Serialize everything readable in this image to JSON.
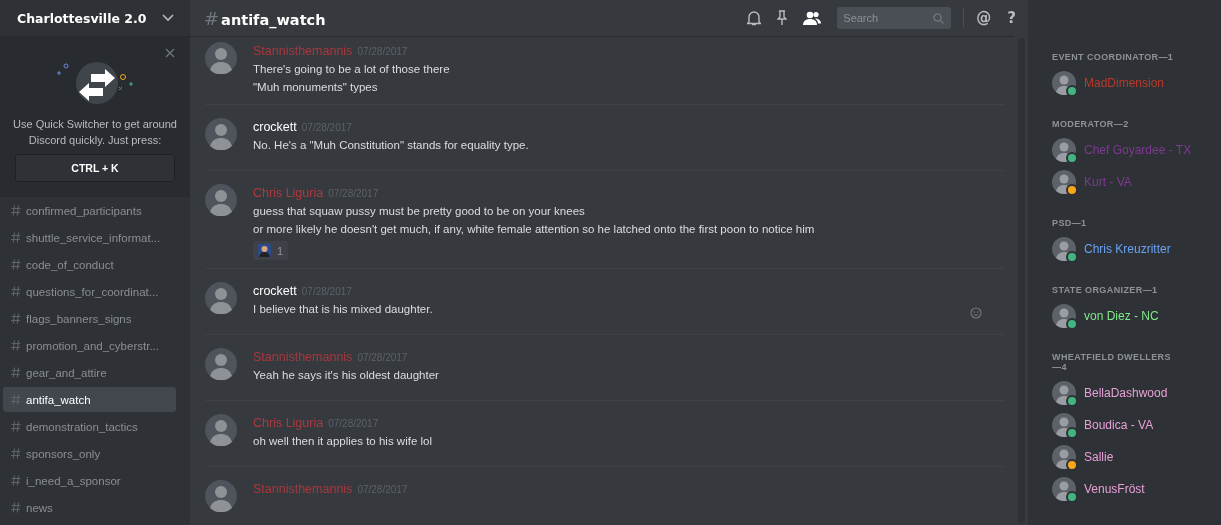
{
  "server": {
    "name": "Charlottesville 2.0"
  },
  "quick_switcher": {
    "text": "Use Quick Switcher to get around Discord quickly. Just press:",
    "shortcut": "CTRL + K"
  },
  "channels": [
    {
      "name": "confirmed_participants",
      "selected": false
    },
    {
      "name": "shuttle_service_informat...",
      "selected": false
    },
    {
      "name": "code_of_conduct",
      "selected": false
    },
    {
      "name": "questions_for_coordinat...",
      "selected": false
    },
    {
      "name": "flags_banners_signs",
      "selected": false
    },
    {
      "name": "promotion_and_cyberstr...",
      "selected": false
    },
    {
      "name": "gear_and_attire",
      "selected": false
    },
    {
      "name": "antifa_watch",
      "selected": true
    },
    {
      "name": "demonstration_tactics",
      "selected": false
    },
    {
      "name": "sponsors_only",
      "selected": false
    },
    {
      "name": "i_need_a_sponsor",
      "selected": false
    },
    {
      "name": "news",
      "selected": false
    }
  ],
  "channel_header": {
    "hash": "#",
    "name": "antifa_watch",
    "search": {
      "placeholder": "Search"
    },
    "at": "@",
    "help": "?"
  },
  "messages": [
    {
      "author": "Stannisthemannis",
      "color": "#a8383e",
      "date": "07/28/2017",
      "lines": [
        "There's going to be a lot of those there",
        "\"Muh monuments\" types"
      ]
    },
    {
      "author": "crockett",
      "color": "#ffffff",
      "date": "07/28/2017",
      "lines": [
        "No. He's a \"Muh Constitution\" stands for equality type."
      ]
    },
    {
      "author": "Chris Liguria",
      "color": "#ad3940",
      "date": "07/28/2017",
      "lines": [
        "guess that squaw pussy must be pretty good to be on your knees",
        "or more likely he doesn't get much, if any, white female attention so he latched onto the first poon to notice him"
      ],
      "reaction": {
        "count": "1"
      }
    },
    {
      "author": "crockett",
      "color": "#ffffff",
      "date": "07/28/2017",
      "lines": [
        "I believe that is his mixed daughter."
      ],
      "hovered": true
    },
    {
      "author": "Stannisthemannis",
      "color": "#a8383e",
      "date": "07/28/2017",
      "lines": [
        "Yeah he says it's his oldest daughter"
      ]
    },
    {
      "author": "Chris Liguria",
      "color": "#ad3940",
      "date": "07/28/2017",
      "lines": [
        "oh well then it applies to his wife lol"
      ]
    },
    {
      "author": "Stannisthemannis",
      "color": "#a8383e",
      "date": "07/28/2017"
    }
  ],
  "member_groups": [
    {
      "title": "EVENT COORDINATOR—1",
      "members": [
        {
          "name": "MadDimension",
          "color": "#b83a2c",
          "idle": false
        }
      ]
    },
    {
      "title": "MODERATOR—2",
      "members": [
        {
          "name": "Chef Goyardee - TX",
          "color": "#7d3a91",
          "idle": false
        },
        {
          "name": "Kurt - VA",
          "color": "#7d3a91",
          "idle": true
        }
      ]
    },
    {
      "title": "PSD—1",
      "members": [
        {
          "name": "Chris Kreuzritter",
          "color": "#6aa2f5",
          "idle": false
        }
      ]
    },
    {
      "title": "STATE ORGANIZER—1",
      "members": [
        {
          "name": "von Diez - NC",
          "color": "#7fe88a",
          "idle": false
        }
      ]
    },
    {
      "title": "WHEATFIELD DWELLERS—4",
      "members": [
        {
          "name": "BellaDashwood",
          "color": "#e8a1d6",
          "idle": false
        },
        {
          "name": "Boudica - VA",
          "color": "#e8a1d6",
          "idle": false
        },
        {
          "name": "Sallie",
          "color": "#e8a1d6",
          "idle": true
        },
        {
          "name": "VenusFröst",
          "color": "#e8a1d6",
          "idle": false
        }
      ]
    }
  ]
}
